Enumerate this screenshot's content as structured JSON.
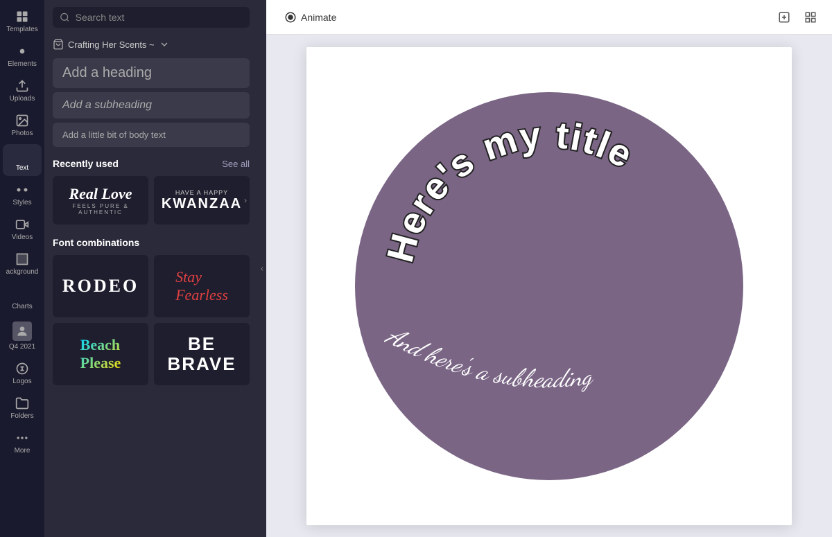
{
  "sidebar": {
    "items": [
      {
        "id": "templates",
        "label": "Templates",
        "icon": "grid"
      },
      {
        "id": "elements",
        "label": "Elements",
        "icon": "elements"
      },
      {
        "id": "uploads",
        "label": "Uploads",
        "icon": "upload"
      },
      {
        "id": "photos",
        "label": "Photos",
        "icon": "photo"
      },
      {
        "id": "text",
        "label": "Text",
        "icon": "text"
      },
      {
        "id": "styles",
        "label": "Styles",
        "icon": "styles"
      },
      {
        "id": "videos",
        "label": "Videos",
        "icon": "video"
      },
      {
        "id": "background",
        "label": "ackground",
        "icon": "background"
      },
      {
        "id": "charts",
        "label": "Charts",
        "icon": "charts"
      },
      {
        "id": "q42021",
        "label": "Q4 2021",
        "icon": "thumbnail"
      },
      {
        "id": "logos",
        "label": "Logos",
        "icon": "logos"
      },
      {
        "id": "folders",
        "label": "Folders",
        "icon": "folders"
      },
      {
        "id": "more",
        "label": "More",
        "icon": "more"
      }
    ]
  },
  "search": {
    "placeholder": "Search text"
  },
  "brand": {
    "name": "Crafting Her Scents ~",
    "icon": "shop-icon"
  },
  "text_options": {
    "heading": "Add a heading",
    "subheading": "Add a subheading",
    "body": "Add a little bit of body text"
  },
  "recently_used": {
    "title": "Recently used",
    "see_all": "See all",
    "items": [
      {
        "id": "real-love",
        "main": "Real Love",
        "sub": "FEELS PURE & AUTHENTIC"
      },
      {
        "id": "kwanzaa",
        "top": "HAVE A HAPPY",
        "main": "KWANZAA"
      }
    ]
  },
  "font_combinations": {
    "title": "Font combinations",
    "items": [
      {
        "id": "rodeo",
        "text": "RODEO"
      },
      {
        "id": "fearless",
        "text": "Stay Fearless"
      },
      {
        "id": "beach",
        "text": "Beach Please"
      },
      {
        "id": "brave",
        "text": "BE BRAVE"
      }
    ]
  },
  "toolbar": {
    "animate_label": "Animate"
  },
  "canvas": {
    "circle_color": "#7a6585",
    "title_text": "Here's my title",
    "subheading_text": "And here's a subheading"
  }
}
